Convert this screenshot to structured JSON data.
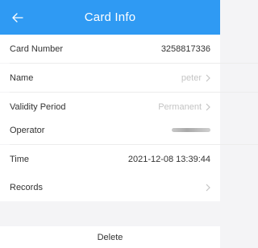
{
  "header": {
    "title": "Card Info",
    "back_icon": "arrow-left-icon"
  },
  "fields": {
    "card_number": {
      "label": "Card Number",
      "value": "3258817336"
    },
    "name": {
      "label": "Name",
      "value": "peter"
    },
    "validity": {
      "label": "Validity Period",
      "value": "Permanent"
    },
    "operator": {
      "label": "Operator",
      "value": ""
    },
    "time": {
      "label": "Time",
      "value": "2021-12-08 13:39:44"
    },
    "records": {
      "label": "Records"
    }
  },
  "actions": {
    "delete_label": "Delete"
  },
  "colors": {
    "accent": "#2f9af3",
    "muted_text": "#c4c4c4",
    "background": "#f4f4f6"
  }
}
